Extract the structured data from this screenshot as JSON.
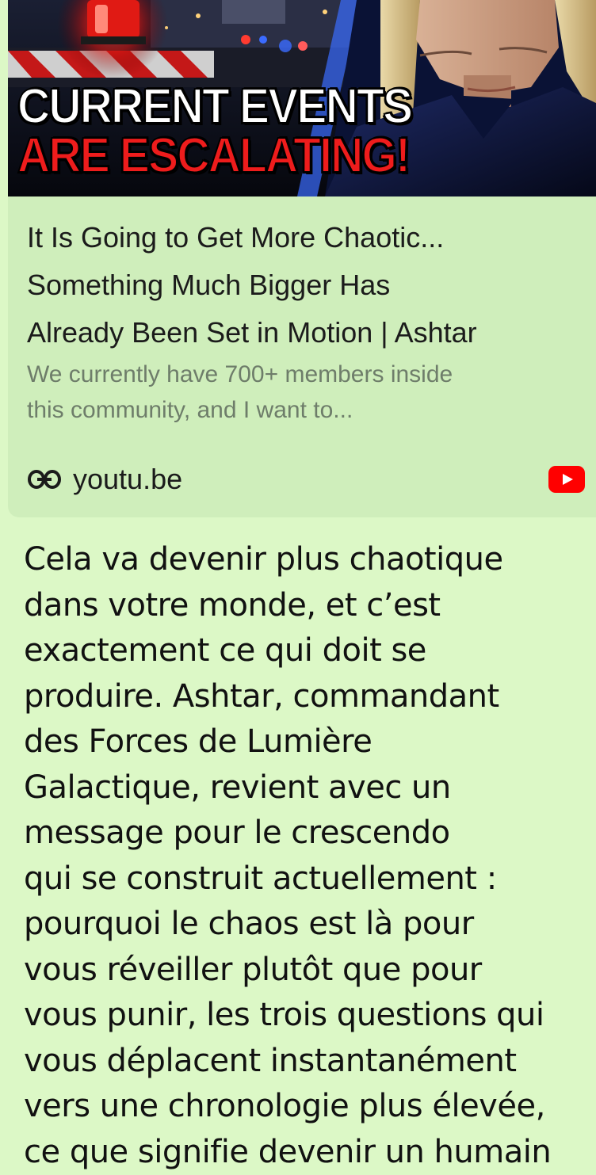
{
  "thumbnail": {
    "headline_line1": "CURRENT EVENTS",
    "headline_line2": "ARE ESCALATING!",
    "line1_color": "#ffffff",
    "line2_color": "#ee1c1c"
  },
  "preview": {
    "title_lines": [
      "It Is Going to Get More Chaotic...",
      "Something Much Bigger Has",
      "Already Been Set in Motion | Ashtar"
    ],
    "description_lines": [
      "We currently have 700+ members inside",
      "this community, and I want to..."
    ],
    "domain": "youtu.be",
    "link_icon": "link-icon",
    "badge_icon": "youtube-icon"
  },
  "message": {
    "lines": [
      "Cela va devenir plus chaotique",
      "dans votre monde, et c’est",
      "exactement ce qui doit se",
      "produire. Ashtar, commandant",
      "des Forces de Lumière",
      "Galactique, revient avec un",
      "message pour le crescendo",
      "qui se construit actuellement :",
      "pourquoi le chaos est là pour",
      "vous réveiller plutôt que pour",
      "vous punir, les trois questions qui",
      "vous déplacent instantanément",
      "vers une chronologie plus élevée,",
      "ce que signifie devenir un humain"
    ]
  },
  "colors": {
    "bubble": "#dcf8c6",
    "preview_bg": "#cfeebb",
    "youtube_red": "#ff0000"
  }
}
